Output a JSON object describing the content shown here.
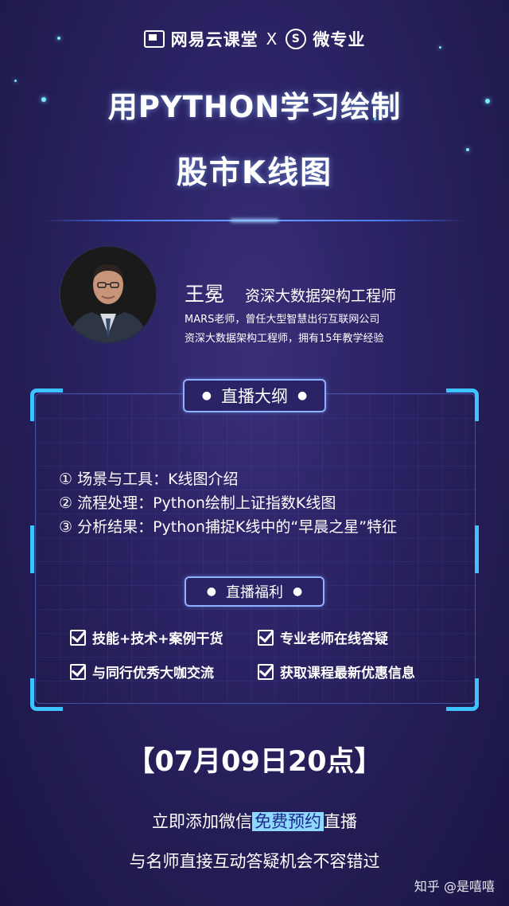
{
  "brand": {
    "left": "网易云课堂",
    "separator": "X",
    "right_mark": "S",
    "right": "微专业"
  },
  "title": {
    "line1": "用PYTHON学习绘制",
    "line2": "股市K线图"
  },
  "teacher": {
    "name": "王冕",
    "role": "资深大数据架构工程师",
    "bio1": "MARS老师，曾任大型智慧出行互联网公司",
    "bio2": "资深大数据架构工程师，拥有15年教学经验"
  },
  "outline": {
    "label": "直播大纲",
    "items": [
      "① 场景与工具：K线图介绍",
      "② 流程处理：Python绘制上证指数K线图",
      "③ 分析结果：Python捕捉K线中的“早晨之星”特征"
    ]
  },
  "benefits": {
    "label": "直播福利",
    "items": [
      "技能+技术+案例干货",
      "专业老师在线答疑",
      "与同行优秀大咖交流",
      "获取课程最新优惠信息"
    ]
  },
  "date": "【07月09日20点】",
  "cta": {
    "pre": "立即添加微信",
    "highlight": "免费预约",
    "post": "直播",
    "line2": "与名师直接互动答疑机会不容错过"
  },
  "watermark": "知乎 @是嘻嘻",
  "colors": {
    "background": "#2c2466",
    "accent": "#3dc3ff",
    "highlight": "#8fd8ff"
  }
}
